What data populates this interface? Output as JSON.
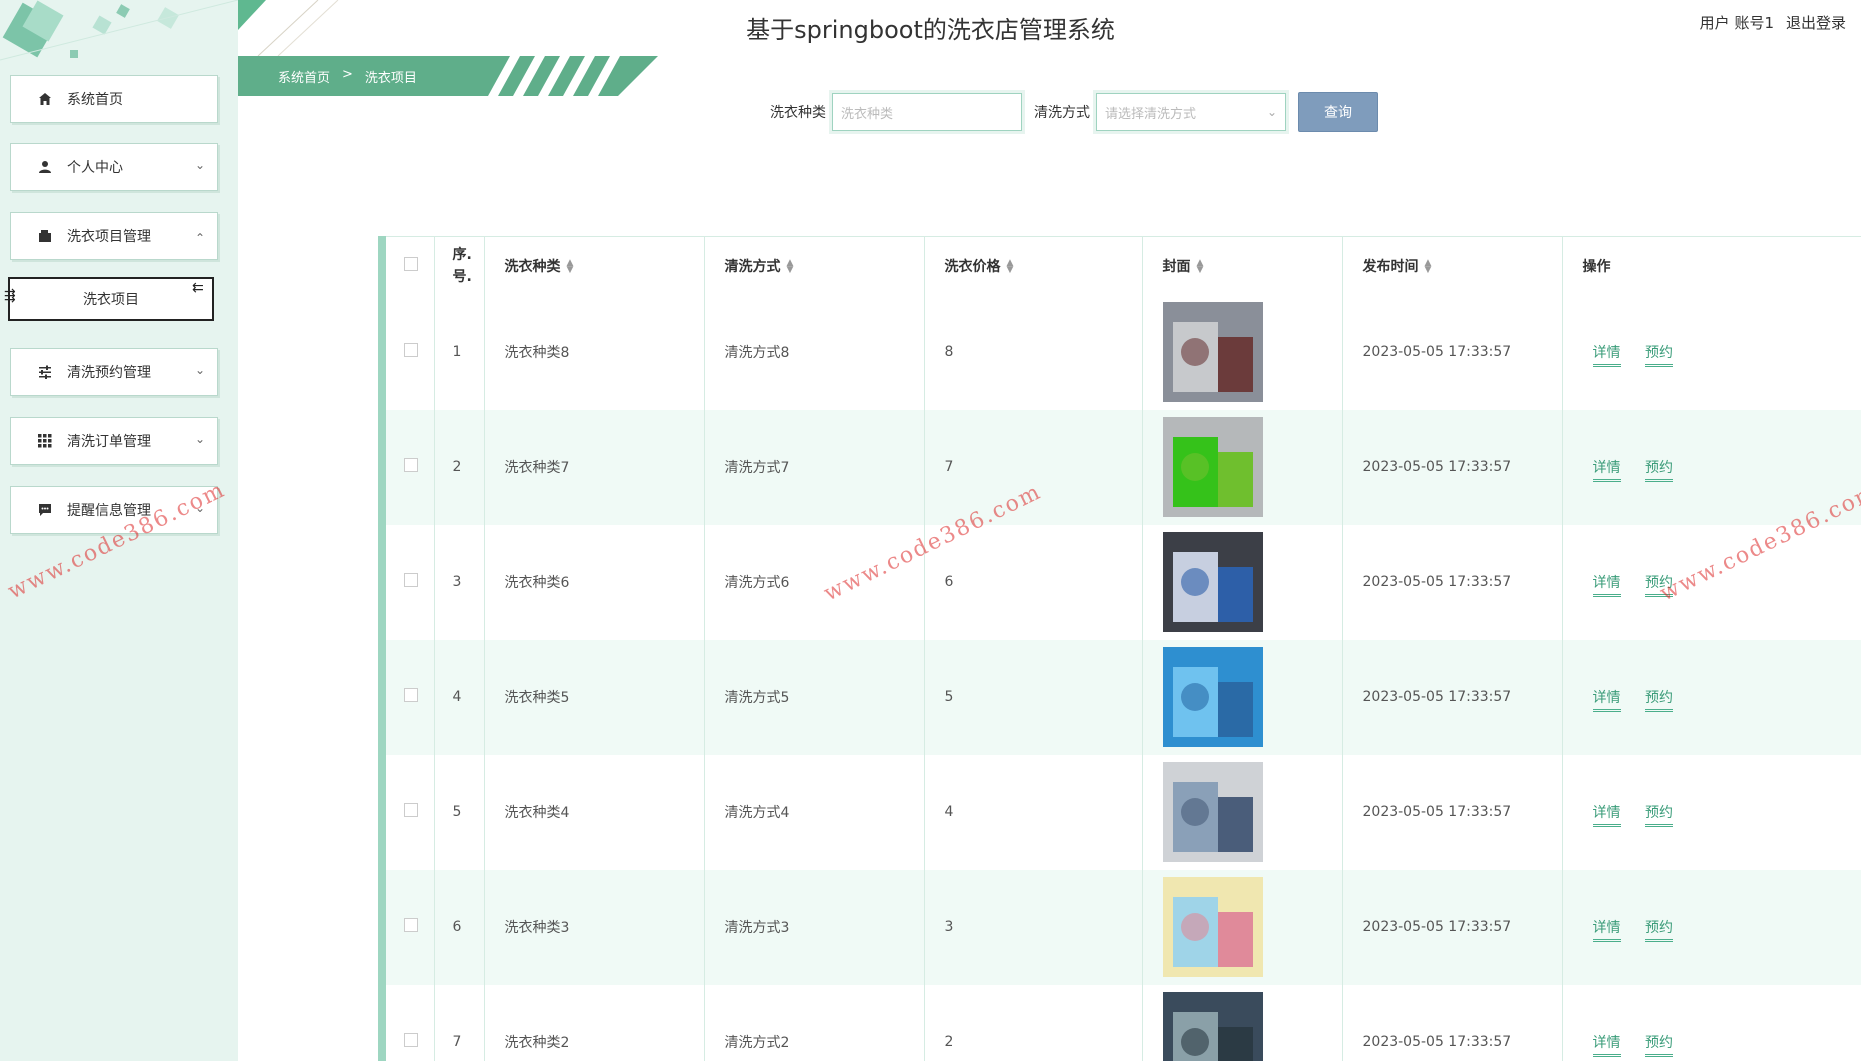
{
  "header": {
    "title": "基于springboot的洗衣店管理系统",
    "user_label": "用户 账号1",
    "logout_label": "退出登录"
  },
  "breadcrumb": {
    "home": "系统首页",
    "separator": ">",
    "current": "洗衣项目"
  },
  "sidebar": {
    "items": [
      {
        "label": "系统首页",
        "icon": "home-icon"
      },
      {
        "label": "个人中心",
        "icon": "user-icon"
      },
      {
        "label": "洗衣项目管理",
        "icon": "wallet-icon"
      },
      {
        "label": "清洗预约管理",
        "icon": "sliders-icon"
      },
      {
        "label": "清洗订单管理",
        "icon": "grid-icon"
      },
      {
        "label": "提醒信息管理",
        "icon": "message-icon"
      }
    ],
    "sub_item": {
      "label": "洗衣项目"
    }
  },
  "search": {
    "type_label": "洗衣种类",
    "type_placeholder": "洗衣种类",
    "method_label": "清洗方式",
    "method_placeholder": "请选择清洗方式",
    "query_button": "查询"
  },
  "table": {
    "headers": {
      "index": "序.\n号.",
      "type": "洗衣种类",
      "method": "清洗方式",
      "price": "洗衣价格",
      "cover": "封面",
      "time": "发布时间",
      "ops": "操作"
    },
    "rows": [
      {
        "index": "1",
        "type": "洗衣种类8",
        "method": "清洗方式8",
        "price": "8",
        "time": "2023-05-05 17:33:57"
      },
      {
        "index": "2",
        "type": "洗衣种类7",
        "method": "清洗方式7",
        "price": "7",
        "time": "2023-05-05 17:33:57"
      },
      {
        "index": "3",
        "type": "洗衣种类6",
        "method": "清洗方式6",
        "price": "6",
        "time": "2023-05-05 17:33:57"
      },
      {
        "index": "4",
        "type": "洗衣种类5",
        "method": "清洗方式5",
        "price": "5",
        "time": "2023-05-05 17:33:57"
      },
      {
        "index": "5",
        "type": "洗衣种类4",
        "method": "清洗方式4",
        "price": "4",
        "time": "2023-05-05 17:33:57"
      },
      {
        "index": "6",
        "type": "洗衣种类3",
        "method": "清洗方式3",
        "price": "3",
        "time": "2023-05-05 17:33:57"
      },
      {
        "index": "7",
        "type": "洗衣种类2",
        "method": "清洗方式2",
        "price": "2",
        "time": "2023-05-05 17:33:57"
      }
    ],
    "detail_label": "详情",
    "reserve_label": "预约"
  },
  "watermark": "www.code386.com",
  "colors": {
    "accent": "#6dbf9f",
    "sidebar_bg": "#e6f4ef",
    "button": "#7f9cbc",
    "link": "#3a9c79",
    "row_alt": "#f0faf6"
  }
}
